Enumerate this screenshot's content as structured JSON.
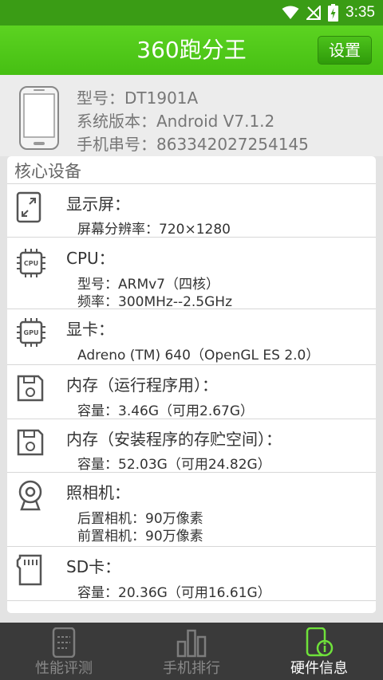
{
  "status_bar": {
    "time": "3:35"
  },
  "app_bar": {
    "title": "360跑分王",
    "settings_label": "设置"
  },
  "device": {
    "model": "型号：DT1901A",
    "system_version": "系统版本：Android V7.1.2",
    "serial": "手机串号：863342027254145"
  },
  "section": {
    "header": "核心设备",
    "rows": [
      {
        "icon": "display-icon",
        "title": "显示屏：",
        "details": [
          "屏幕分辨率：720×1280"
        ]
      },
      {
        "icon": "cpu-icon",
        "title": "CPU：",
        "details": [
          "型号：ARMv7（四核）",
          "频率：300MHz--2.5GHz"
        ]
      },
      {
        "icon": "gpu-icon",
        "title": "显卡：",
        "details": [
          "Adreno (TM) 640（OpenGL ES 2.0）"
        ]
      },
      {
        "icon": "memory-icon",
        "title": "内存（运行程序用）：",
        "details": [
          "容量：3.46G（可用2.67G）"
        ]
      },
      {
        "icon": "storage-icon",
        "title": "内存（安装程序的存贮空间）：",
        "details": [
          "容量：52.03G（可用24.82G）"
        ]
      },
      {
        "icon": "camera-icon",
        "title": "照相机：",
        "details": [
          "后置相机：90万像素",
          "前置相机：90万像素"
        ]
      },
      {
        "icon": "sd-card-icon",
        "title": "SD卡：",
        "details": [
          "容量：20.36G（可用16.61G）"
        ]
      }
    ]
  },
  "tabs": [
    {
      "label": "性能评测",
      "active": false
    },
    {
      "label": "手机排行",
      "active": false
    },
    {
      "label": "硬件信息",
      "active": true
    }
  ],
  "colors": {
    "accent": "#4cc31a",
    "status_bar": "#3a9c15",
    "tab_bar": "#3a3a3a",
    "active_icon": "#6fe23a"
  }
}
